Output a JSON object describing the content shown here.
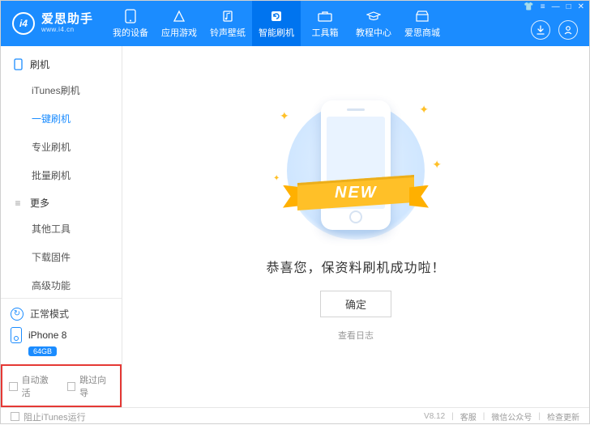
{
  "brand": {
    "logo_text": "i4",
    "name_cn": "爱思助手",
    "name_en": "www.i4.cn"
  },
  "nav": [
    {
      "label": "我的设备",
      "icon": "phone-icon"
    },
    {
      "label": "应用游戏",
      "icon": "apps-icon"
    },
    {
      "label": "铃声壁纸",
      "icon": "music-icon"
    },
    {
      "label": "智能刷机",
      "icon": "flash-icon",
      "active": true
    },
    {
      "label": "工具箱",
      "icon": "toolbox-icon"
    },
    {
      "label": "教程中心",
      "icon": "tutorial-icon"
    },
    {
      "label": "爱思商城",
      "icon": "store-icon"
    }
  ],
  "sidebar": {
    "groups": [
      {
        "title": "刷机",
        "icon": "phone-outline-icon",
        "items": [
          "iTunes刷机",
          "一键刷机",
          "专业刷机",
          "批量刷机"
        ],
        "active_index": 1
      },
      {
        "title": "更多",
        "icon": "menu-icon",
        "items": [
          "其他工具",
          "下载固件",
          "高级功能"
        ]
      }
    ],
    "mode": {
      "label": "正常模式"
    },
    "device": {
      "name": "iPhone 8",
      "storage": "64GB"
    },
    "checks": {
      "auto_activate": "自动激活",
      "skip_guide": "跳过向导"
    }
  },
  "content": {
    "ribbon_text": "NEW",
    "success_text": "恭喜您，保资料刷机成功啦！",
    "ok_label": "确定",
    "log_label": "查看日志"
  },
  "footer": {
    "block_itunes": "阻止iTunes运行",
    "version": "V8.12",
    "support": "客服",
    "wechat": "微信公众号",
    "update": "检查更新"
  }
}
